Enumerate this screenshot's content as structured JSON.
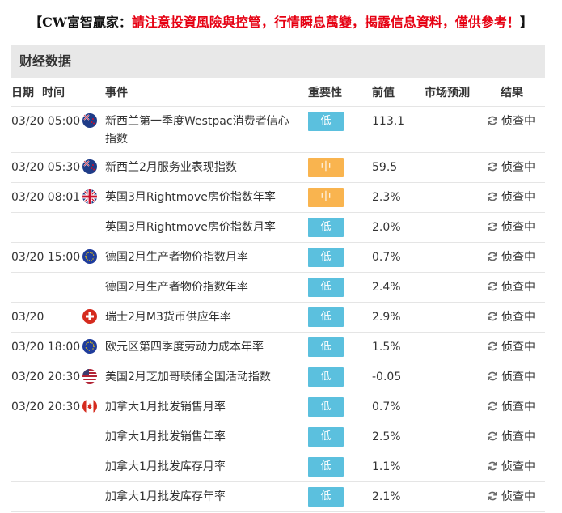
{
  "banner": {
    "open": "【",
    "brand": "CW富智贏家：",
    "warning": "請注意投資風險與控管，行情瞬息萬變，揭露信息資料，僅供參考！",
    "close": "】"
  },
  "section_title": "财经数据",
  "columns": {
    "date": "日期",
    "time": "时间",
    "event": "事件",
    "importance": "重要性",
    "previous": "前值",
    "forecast": "市场预测",
    "result": "结果"
  },
  "colors": {
    "warning_red": "#e60012",
    "low_badge": "#5bc0de",
    "mid_badge": "#f9b44f",
    "header_bg": "#e8e8e8"
  },
  "rows": [
    {
      "time": "03/20 05:00",
      "flag": "nz-flag-icon",
      "event": "新西兰第一季度Westpac消费者信心指数",
      "importance": "低",
      "level": "low",
      "previous": "113.1",
      "forecast": "",
      "result": "侦查中"
    },
    {
      "time": "03/20 05:30",
      "flag": "nz-flag-icon",
      "event": "新西兰2月服务业表现指数",
      "importance": "中",
      "level": "mid",
      "previous": "59.5",
      "forecast": "",
      "result": "侦查中"
    },
    {
      "time": "03/20 08:01",
      "flag": "uk-flag-icon",
      "event": "英国3月Rightmove房价指数年率",
      "importance": "中",
      "level": "mid",
      "previous": "2.3%",
      "forecast": "",
      "result": "侦查中"
    },
    {
      "time": "",
      "flag": "",
      "event": "英国3月Rightmove房价指数月率",
      "importance": "低",
      "level": "low",
      "previous": "2.0%",
      "forecast": "",
      "result": "侦查中"
    },
    {
      "time": "03/20 15:00",
      "flag": "eu-flag-icon",
      "event": "德国2月生产者物价指数月率",
      "importance": "低",
      "level": "low",
      "previous": "0.7%",
      "forecast": "",
      "result": "侦查中"
    },
    {
      "time": "",
      "flag": "",
      "event": "德国2月生产者物价指数年率",
      "importance": "低",
      "level": "low",
      "previous": "2.4%",
      "forecast": "",
      "result": "侦查中"
    },
    {
      "time": "03/20",
      "flag": "ch-flag-icon",
      "event": "瑞士2月M3货币供应年率",
      "importance": "低",
      "level": "low",
      "previous": "2.9%",
      "forecast": "",
      "result": "侦查中"
    },
    {
      "time": "03/20 18:00",
      "flag": "eu-flag-icon",
      "event": "欧元区第四季度劳动力成本年率",
      "importance": "低",
      "level": "low",
      "previous": "1.5%",
      "forecast": "",
      "result": "侦查中"
    },
    {
      "time": "03/20 20:30",
      "flag": "us-flag-icon",
      "event": "美国2月芝加哥联储全国活动指数",
      "importance": "低",
      "level": "low",
      "previous": "-0.05",
      "forecast": "",
      "result": "侦查中"
    },
    {
      "time": "03/20 20:30",
      "flag": "ca-flag-icon",
      "event": "加拿大1月批发销售月率",
      "importance": "低",
      "level": "low",
      "previous": "0.7%",
      "forecast": "",
      "result": "侦查中"
    },
    {
      "time": "",
      "flag": "",
      "event": "加拿大1月批发销售年率",
      "importance": "低",
      "level": "low",
      "previous": "2.5%",
      "forecast": "",
      "result": "侦查中"
    },
    {
      "time": "",
      "flag": "",
      "event": "加拿大1月批发库存月率",
      "importance": "低",
      "level": "low",
      "previous": "1.1%",
      "forecast": "",
      "result": "侦查中"
    },
    {
      "time": "",
      "flag": "",
      "event": "加拿大1月批发库存年率",
      "importance": "低",
      "level": "low",
      "previous": "2.1%",
      "forecast": "",
      "result": "侦查中"
    }
  ]
}
